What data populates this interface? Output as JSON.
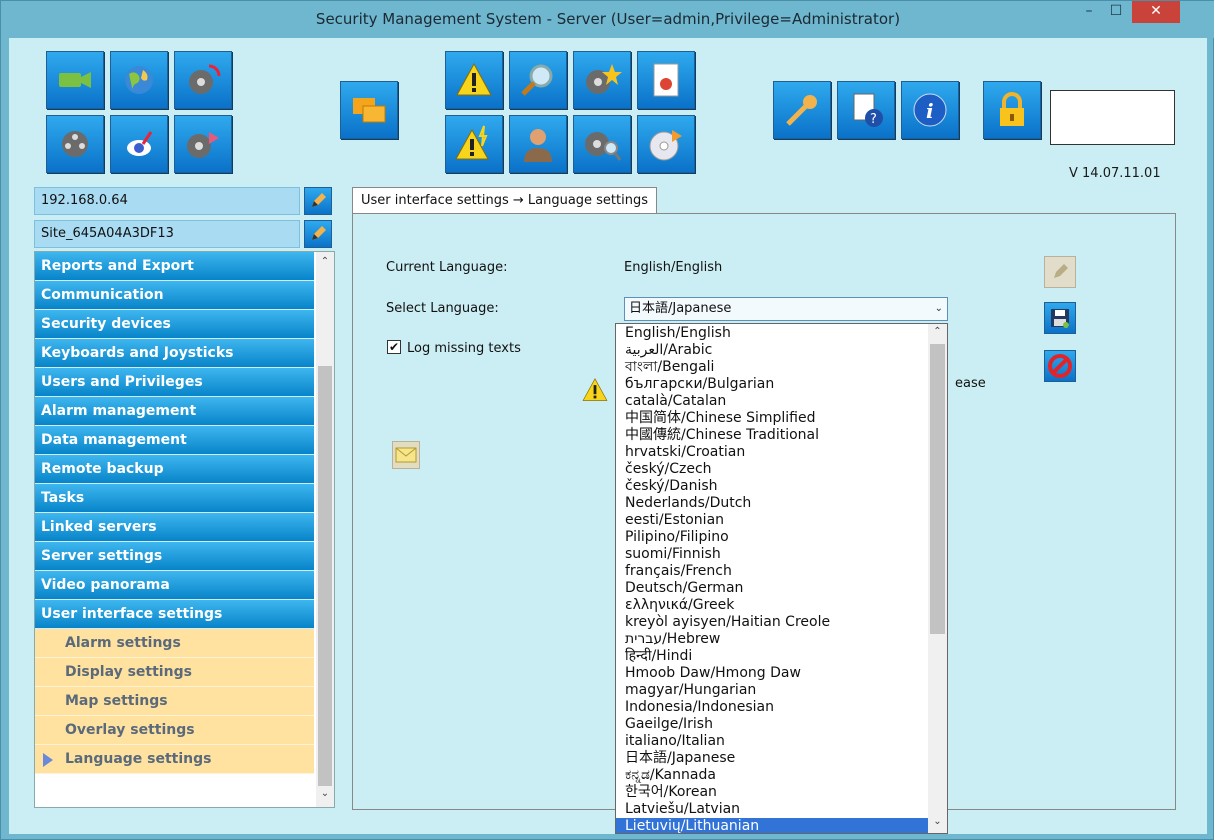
{
  "window": {
    "title": "Security Management System - Server (User=admin,Privilege=Administrator)",
    "min_glyph": "–",
    "max_glyph": "☐",
    "close_glyph": "✕"
  },
  "toolbar": {
    "version": "V 14.07.11.01",
    "icons": [
      "camera-icon",
      "globe-icon",
      "film-refresh-icon",
      "film-reel-icon",
      "map-pointer-icon",
      "film-export-icon",
      "windows-icon",
      "warning-icon",
      "search-icon",
      "film-star-icon",
      "report-icon",
      "warning-lightning-icon",
      "user-icon",
      "film-search-icon",
      "disc-export-icon",
      "key-icon",
      "help-document-icon",
      "info-icon",
      "lock-icon"
    ]
  },
  "server": {
    "ip": "192.168.0.64",
    "site": "Site_645A04A3DF13"
  },
  "nav": {
    "items": [
      "Reports and Export",
      "Communication",
      "Security devices",
      "Keyboards and Joysticks",
      "Users and Privileges",
      "Alarm management",
      "Data management",
      "Remote backup",
      "Tasks",
      "Linked servers",
      "Server settings",
      "Video panorama",
      "User interface settings"
    ],
    "subitems": [
      "Alarm settings",
      "Display settings",
      "Map settings",
      "Overlay settings",
      "Language settings"
    ],
    "active_subitem": "Language settings"
  },
  "tab": {
    "label": "User interface settings → Language settings"
  },
  "form": {
    "current_language_label": "Current Language:",
    "current_language_value": "English/English",
    "select_language_label": "Select Language:",
    "select_language_value": "日本語/Japanese",
    "log_missing_label": "Log missing texts",
    "log_missing_checked": "✔",
    "partial_text": "ease"
  },
  "dropdown": {
    "options": [
      "English/English",
      "العربية/Arabic",
      "বাংলা/Bengali",
      "български/Bulgarian",
      "català/Catalan",
      "中国简体/Chinese Simplified",
      "中國傳統/Chinese Traditional",
      "hrvatski/Croatian",
      "český/Czech",
      "český/Danish",
      "Nederlands/Dutch",
      "eesti/Estonian",
      "Pilipino/Filipino",
      "suomi/Finnish",
      "français/French",
      "Deutsch/German",
      "ελληνικά/Greek",
      "kreyòl ayisyen/Haitian Creole",
      "עברית/Hebrew",
      "हिन्दी/Hindi",
      "Hmoob Daw/Hmong Daw",
      "magyar/Hungarian",
      "Indonesia/Indonesian",
      "Gaeilge/Irish",
      "italiano/Italian",
      "日本語/Japanese",
      "ಕನ್ನಡ/Kannada",
      "한국어/Korean",
      "Latviešu/Latvian",
      "Lietuvių/Lithuanian"
    ],
    "selected": "Lietuvių/Lithuanian"
  }
}
